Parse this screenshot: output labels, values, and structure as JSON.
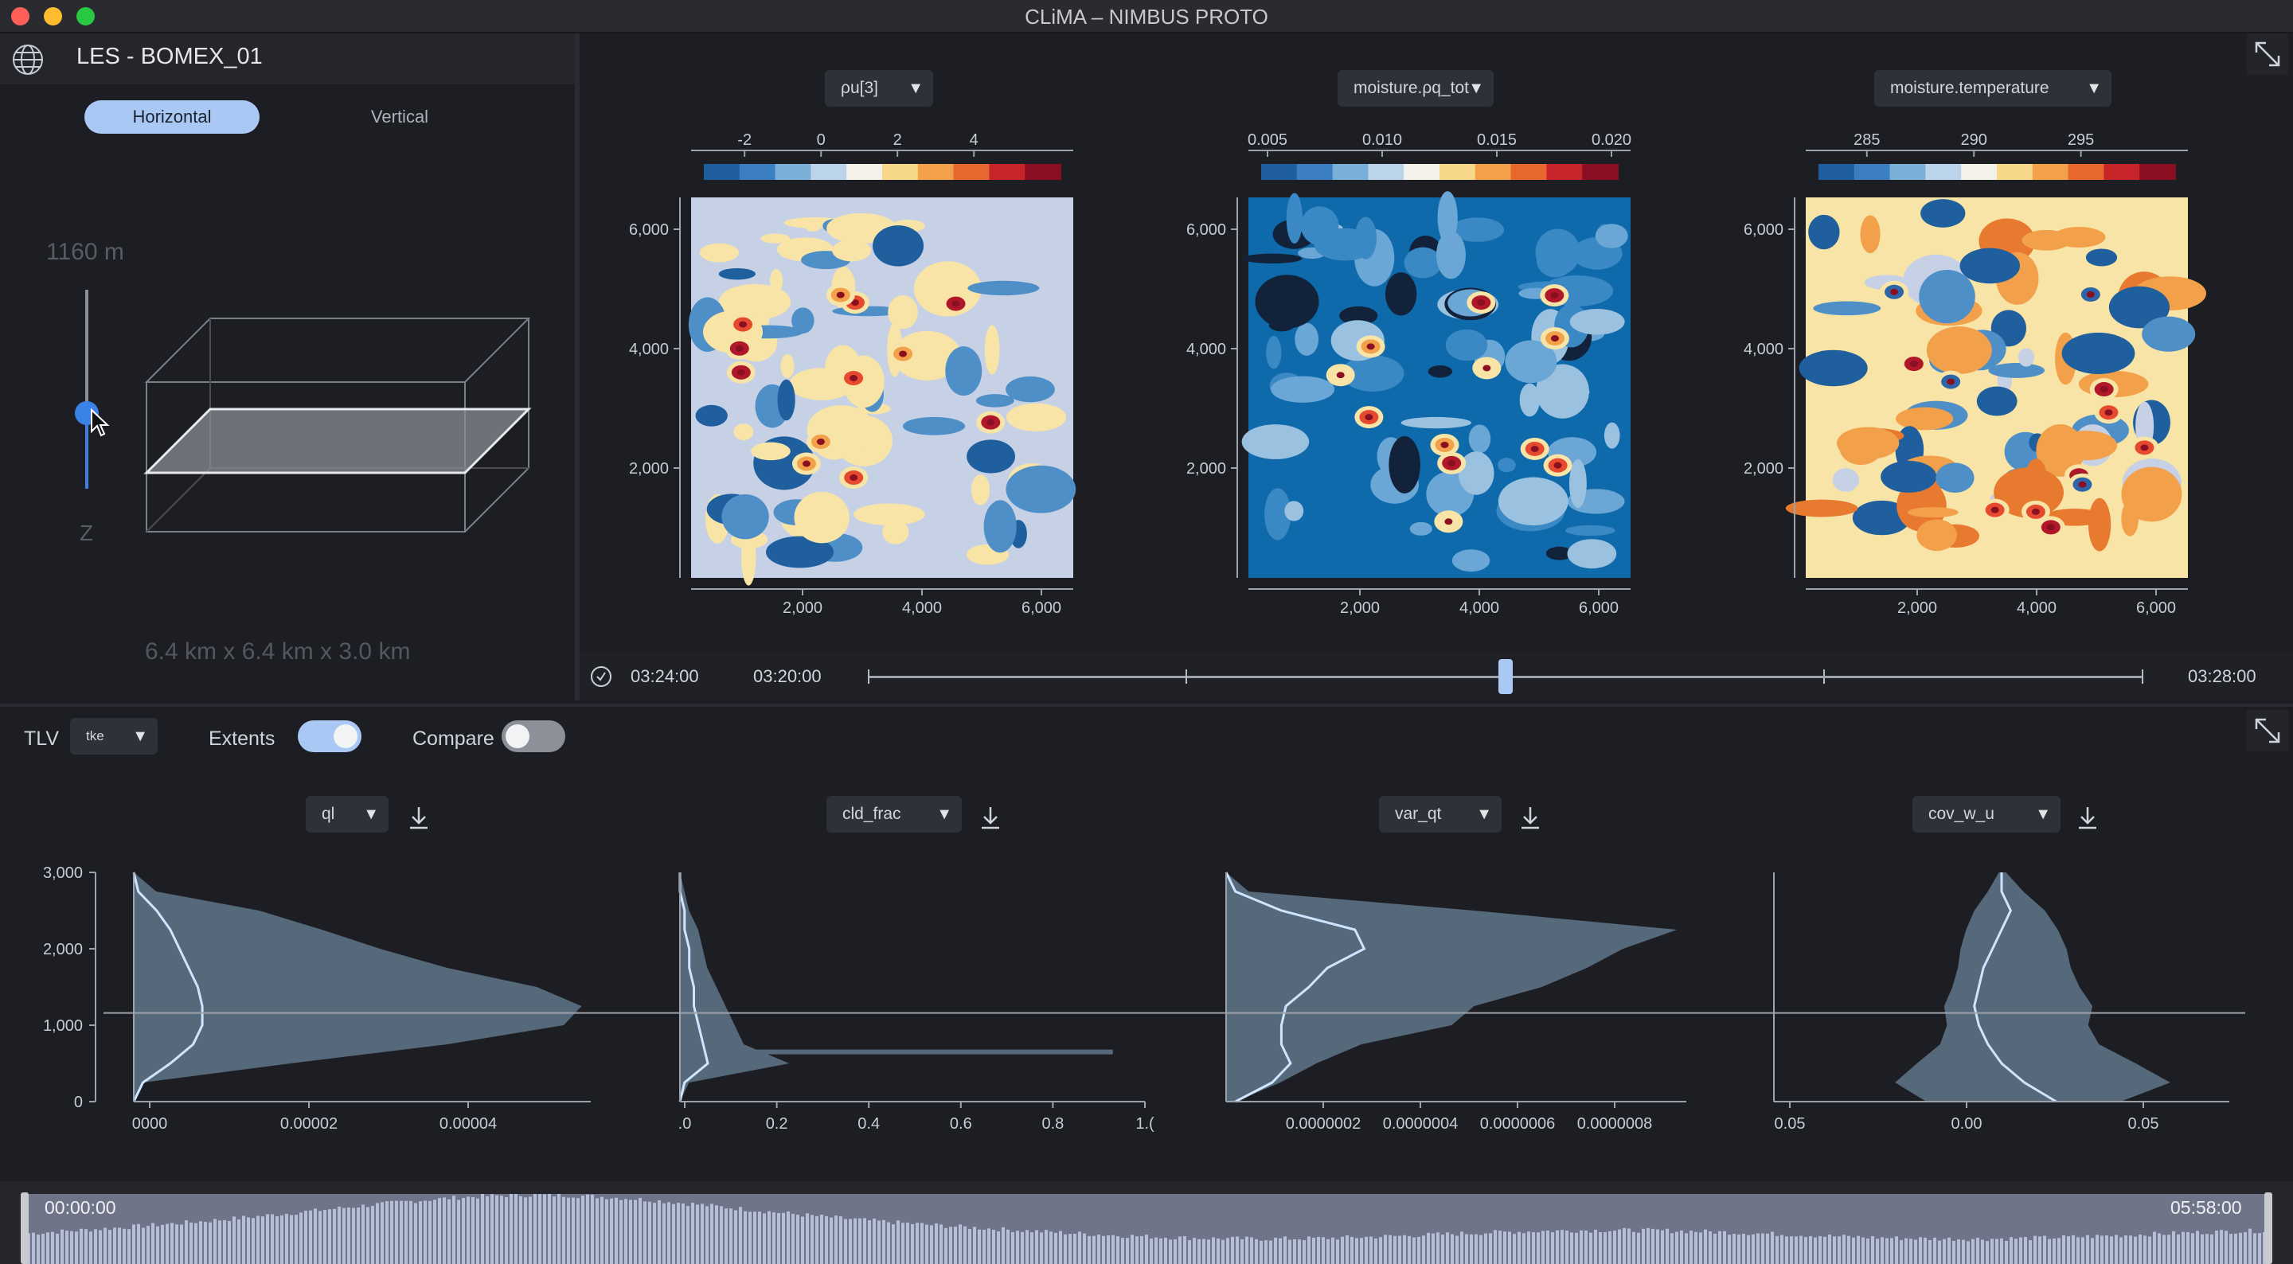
{
  "window": {
    "title": "CLiMA – NIMBUS PROTO"
  },
  "left_panel": {
    "title": "LES - BOMEX_01",
    "mode_tabs": [
      "Horizontal",
      "Vertical"
    ],
    "height_value": "1160 m",
    "axis_label": "Z",
    "slider_level": 0.47,
    "domain_size": "6.4 km x 6.4 km x 3.0 km"
  },
  "horizontal_maps": [
    {
      "variable": "ρu[3]",
      "colorbar_ticks": [
        "-2",
        "0",
        "2",
        "4"
      ],
      "y_ticks": [
        "6,000",
        "4,000",
        "2,000"
      ],
      "x_ticks": [
        "2,000",
        "4,000",
        "6,000"
      ]
    },
    {
      "variable": "moisture.ρq_tot",
      "colorbar_ticks": [
        "0.005",
        "0.010",
        "0.015",
        "0.020"
      ],
      "y_ticks": [
        "6,000",
        "4,000",
        "2,000"
      ],
      "x_ticks": [
        "2,000",
        "4,000",
        "6,000"
      ]
    },
    {
      "variable": "moisture.temperature",
      "colorbar_ticks": [
        "285",
        "290",
        "295"
      ],
      "y_ticks": [
        "6,000",
        "4,000",
        "2,000"
      ],
      "x_ticks": [
        "2,000",
        "4,000",
        "6,000"
      ]
    }
  ],
  "time_control": {
    "current_time": "03:24:00",
    "range_start": "03:20:00",
    "range_end": "03:28:00",
    "position": 0.5
  },
  "profile_controls": {
    "tlv_label": "TLV",
    "tlv_value": "tke",
    "extents_label": "Extents",
    "extents_on": true,
    "compare_label": "Compare",
    "compare_on": false
  },
  "profiles": [
    {
      "variable": "ql",
      "x_ticks": [
        "0000",
        "0.00002",
        "0.00004"
      ]
    },
    {
      "variable": "cld_frac",
      "x_ticks": [
        ".0",
        "0.2",
        "0.4",
        "0.6",
        "0.8",
        "1.("
      ]
    },
    {
      "variable": "var_qt",
      "x_ticks": [
        "0.0000002",
        "0.0000004",
        "0.0000006",
        "0.0000008"
      ]
    },
    {
      "variable": "cov_w_u",
      "x_ticks": [
        "0.05",
        "0.00",
        "0.05"
      ]
    }
  ],
  "profile_y_ticks": [
    "3,000",
    "2,000",
    "1,000",
    "0"
  ],
  "timeline": {
    "start": "00:00:00",
    "end": "05:58:00"
  },
  "colors": {
    "accent": "#aac8f4",
    "slider_knob": "#3b82e6",
    "profile_fill": "#56697a",
    "profile_line": "#cfe4ff"
  },
  "icons": [
    "globe-icon",
    "maximize-icon",
    "clock-icon",
    "download-icon",
    "chevron-down-icon"
  ]
}
